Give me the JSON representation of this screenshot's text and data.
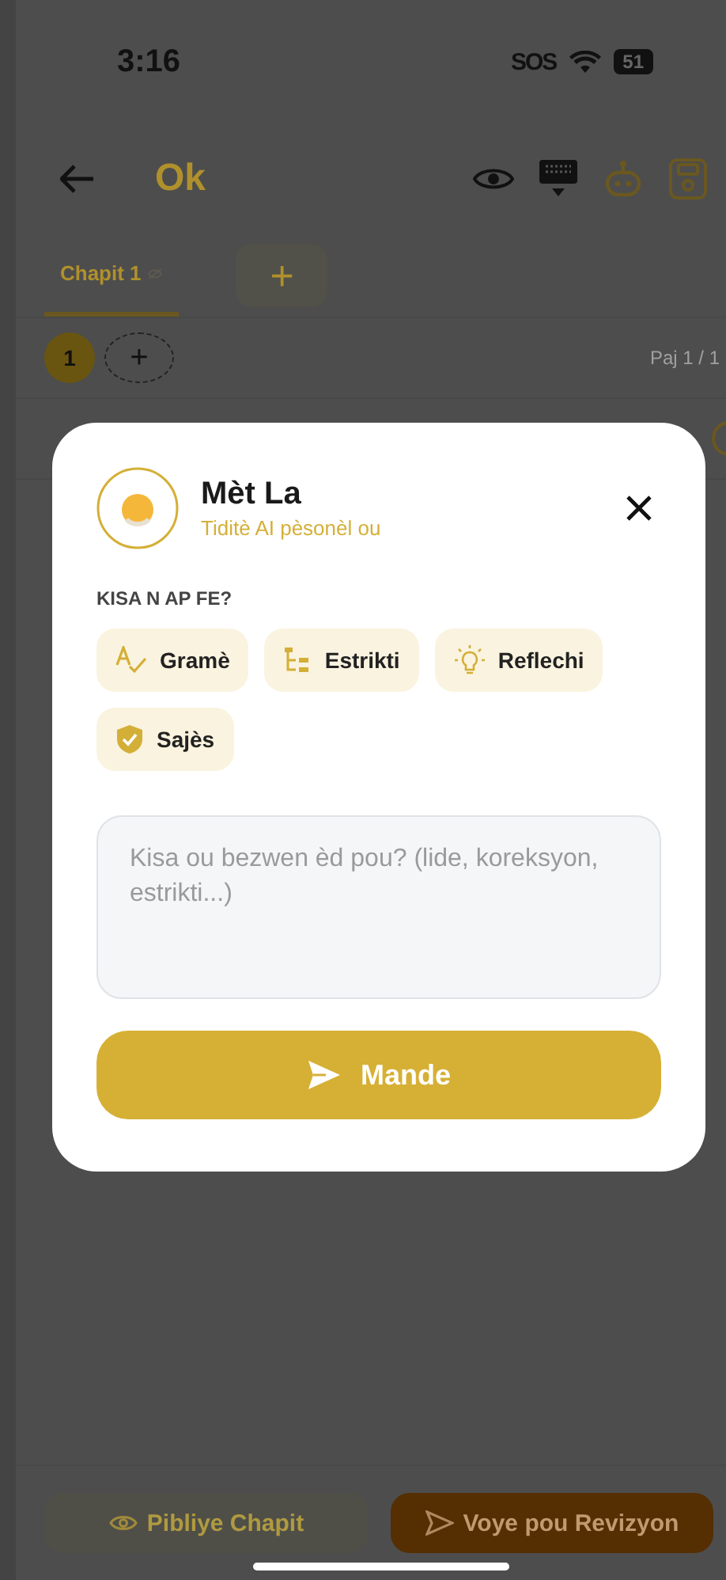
{
  "status_bar": {
    "time": "3:16",
    "sos": "SOS",
    "battery": "51"
  },
  "header": {
    "title": "Ok"
  },
  "tabs": [
    {
      "label": "Chapit 1",
      "selected": true
    }
  ],
  "add_chapter_button": "+",
  "pages": [
    {
      "label": "1",
      "selected": true
    }
  ],
  "add_page_button": "+",
  "page_indicator": "Paj 1 / 1",
  "modal": {
    "title": "Mèt La",
    "subtitle": "Tiditè AI pèsonèl ou",
    "section_label": "KISA N AP FE?",
    "actions": [
      {
        "label": "Gramè",
        "kind": "grammar"
      },
      {
        "label": "Estrikti",
        "kind": "structure"
      },
      {
        "label": "Reflechi",
        "kind": "idea"
      },
      {
        "label": "Sajès",
        "kind": "wisdom"
      }
    ],
    "question": {
      "placeholder": "Kisa ou bezwen èd pou? (lide, koreksyon, estrikti...)"
    },
    "submit_button": "Mande"
  },
  "bottom_bar": {
    "publish_button": "Pibliye Chapit",
    "send_button": "Voye pou Revizyon"
  }
}
